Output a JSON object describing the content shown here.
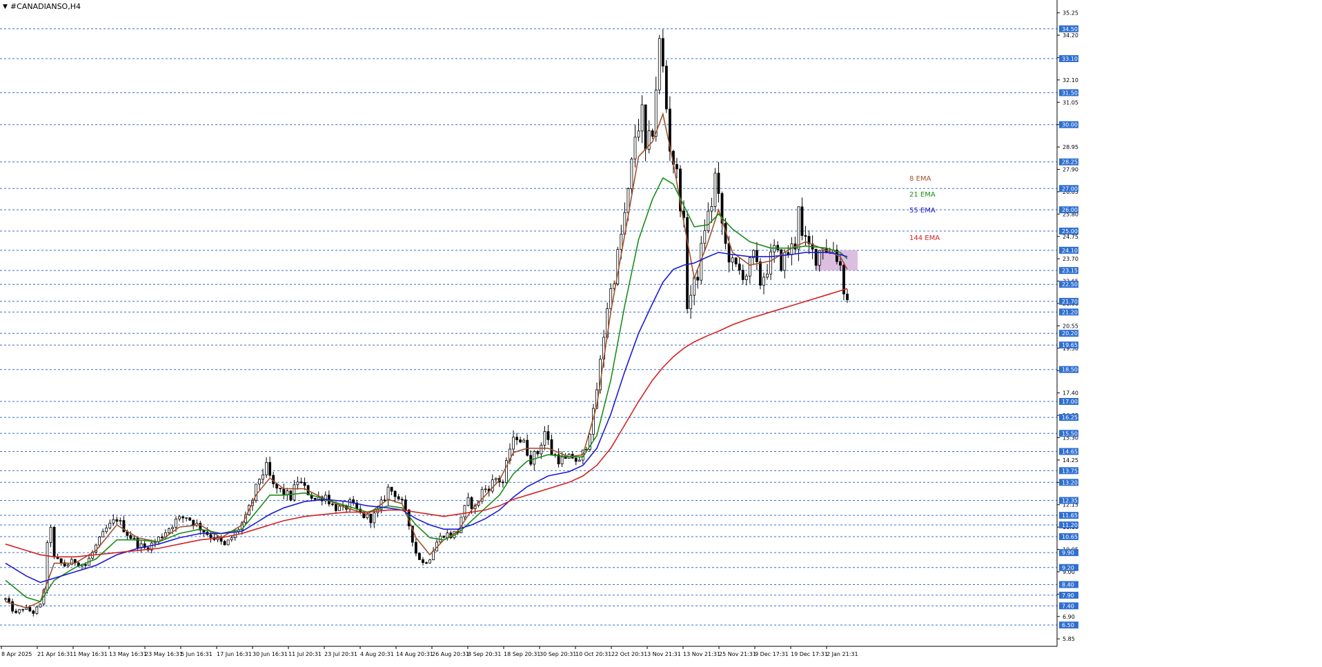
{
  "window": {
    "title": "#CANADIANSO,H4"
  },
  "chart_data": {
    "type": "line",
    "title": "#CANADIANSO,H4",
    "ylim": [
      5.5,
      35.4
    ],
    "price_axis_ticks": [
      "35.25",
      "34.20",
      "33.15",
      "32.10",
      "31.05",
      "30.00",
      "28.95",
      "27.90",
      "26.85",
      "25.80",
      "24.75",
      "23.70",
      "22.65",
      "21.60",
      "20.55",
      "19.50",
      "18.45",
      "17.40",
      "16.35",
      "15.30",
      "14.25",
      "13.20",
      "12.15",
      "11.10",
      "10.05",
      "9.00",
      "7.95",
      "6.90",
      "5.85"
    ],
    "x_axis_labels": [
      "8 Apr 2025",
      "21 Apr 16:31",
      "1 May 16:31",
      "13 May 16:31",
      "23 May 16:31",
      "5 Jun 16:31",
      "17 Jun 16:31",
      "30 Jun 16:31",
      "11 Jul 20:31",
      "23 Jul 20:31",
      "4 Aug 20:31",
      "14 Aug 20:31",
      "26 Aug 20:31",
      "8 Sep 20:31",
      "18 Sep 20:31",
      "30 Sep 20:31",
      "10 Oct 20:31",
      "22 Oct 20:31",
      "3 Nov 21:31",
      "13 Nov 21:31",
      "25 Nov 21:31",
      "9 Dec 17:31",
      "19 Dec 17:31",
      "2 Jan 21:31"
    ],
    "horizontal_levels": [
      "34.50",
      "33.10",
      "31.50",
      "30.00",
      "28.25",
      "27.00",
      "26.00",
      "25.00",
      "24.10",
      "23.15",
      "22.50",
      "21.70",
      "21.20",
      "20.20",
      "19.65",
      "18.50",
      "17.00",
      "16.25",
      "15.50",
      "14.65",
      "13.75",
      "13.20",
      "12.35",
      "11.65",
      "11.20",
      "10.65",
      "9.90",
      "9.20",
      "8.40",
      "7.90",
      "7.40",
      "6.50"
    ],
    "level_color": "#2f6fd1",
    "zone": {
      "from": 23.15,
      "to": 24.1,
      "color": "#d8b7de"
    },
    "colors": {
      "bull_candle": "#ffffff",
      "bear_candle": "#000000",
      "wick": "#000000"
    },
    "ohlc_points": [
      [
        0,
        7.7
      ],
      [
        3,
        7.0
      ],
      [
        5,
        7.3
      ],
      [
        8,
        7.1
      ],
      [
        10,
        7.4
      ],
      [
        11,
        8.2
      ],
      [
        12,
        10.2
      ],
      [
        13,
        11.2
      ],
      [
        14,
        9.6
      ],
      [
        17,
        9.3
      ],
      [
        20,
        9.5
      ],
      [
        23,
        9.3
      ],
      [
        26,
        10.2
      ],
      [
        29,
        11.0
      ],
      [
        32,
        11.5
      ],
      [
        35,
        10.8
      ],
      [
        38,
        10.3
      ],
      [
        40,
        10.1
      ],
      [
        43,
        10.4
      ],
      [
        46,
        10.9
      ],
      [
        49,
        11.4
      ],
      [
        52,
        11.6
      ],
      [
        55,
        11.2
      ],
      [
        58,
        10.8
      ],
      [
        61,
        10.5
      ],
      [
        63,
        10.2
      ],
      [
        66,
        10.8
      ],
      [
        69,
        11.5
      ],
      [
        71,
        12.4
      ],
      [
        73,
        13.4
      ],
      [
        75,
        13.9
      ],
      [
        77,
        13.0
      ],
      [
        79,
        12.8
      ],
      [
        82,
        12.5
      ],
      [
        84,
        13.3
      ],
      [
        86,
        12.9
      ],
      [
        89,
        12.4
      ],
      [
        92,
        12.6
      ],
      [
        94,
        12.1
      ],
      [
        97,
        11.9
      ],
      [
        99,
        12.2
      ],
      [
        102,
        11.7
      ],
      [
        105,
        11.5
      ],
      [
        107,
        11.8
      ],
      [
        110,
        12.9
      ],
      [
        112,
        12.7
      ],
      [
        114,
        12.2
      ],
      [
        116,
        11.2
      ],
      [
        118,
        9.9
      ],
      [
        120,
        9.4
      ],
      [
        122,
        9.7
      ],
      [
        124,
        10.4
      ],
      [
        126,
        10.8
      ],
      [
        128,
        10.7
      ],
      [
        130,
        10.9
      ],
      [
        131,
        11.6
      ],
      [
        133,
        12.3
      ],
      [
        135,
        12.0
      ],
      [
        137,
        12.8
      ],
      [
        139,
        13.0
      ],
      [
        141,
        13.4
      ],
      [
        143,
        13.2
      ],
      [
        145,
        14.8
      ],
      [
        147,
        15.4
      ],
      [
        149,
        15.0
      ],
      [
        151,
        14.3
      ],
      [
        153,
        14.6
      ],
      [
        155,
        15.6
      ],
      [
        157,
        14.6
      ],
      [
        159,
        14.3
      ],
      [
        161,
        14.2
      ],
      [
        163,
        14.4
      ],
      [
        165,
        14.1
      ],
      [
        167,
        15.0
      ],
      [
        169,
        16.4
      ],
      [
        171,
        18.8
      ],
      [
        173,
        21.5
      ],
      [
        175,
        22.9
      ],
      [
        177,
        24.8
      ],
      [
        179,
        26.7
      ],
      [
        181,
        29.5
      ],
      [
        183,
        30.5
      ],
      [
        184,
        28.6
      ],
      [
        186,
        29.8
      ],
      [
        188,
        33.8
      ],
      [
        189,
        32.6
      ],
      [
        190,
        30.8
      ],
      [
        191,
        29.0
      ],
      [
        193,
        27.6
      ],
      [
        195,
        25.2
      ],
      [
        196,
        21.6
      ],
      [
        197,
        22.0
      ],
      [
        199,
        23.0
      ],
      [
        201,
        25.2
      ],
      [
        203,
        26.3
      ],
      [
        204,
        27.6
      ],
      [
        205,
        26.4
      ],
      [
        207,
        24.3
      ],
      [
        209,
        23.4
      ],
      [
        211,
        23.1
      ],
      [
        213,
        23.0
      ],
      [
        215,
        23.8
      ],
      [
        217,
        22.6
      ],
      [
        219,
        23.3
      ],
      [
        221,
        24.1
      ],
      [
        223,
        23.5
      ],
      [
        225,
        24.0
      ],
      [
        227,
        24.4
      ],
      [
        228,
        26.4
      ],
      [
        229,
        24.6
      ],
      [
        231,
        24.2
      ],
      [
        233,
        23.8
      ],
      [
        235,
        24.4
      ],
      [
        237,
        24.0
      ],
      [
        238,
        24.2
      ],
      [
        240,
        23.4
      ],
      [
        241,
        22.3
      ],
      [
        242,
        21.7
      ]
    ],
    "series": [
      {
        "name": "8 EMA",
        "color": "#a0522d",
        "values": [
          [
            0,
            7.6
          ],
          [
            6,
            7.3
          ],
          [
            10,
            7.6
          ],
          [
            14,
            9.4
          ],
          [
            20,
            9.4
          ],
          [
            26,
            10.0
          ],
          [
            32,
            11.2
          ],
          [
            38,
            10.6
          ],
          [
            44,
            10.4
          ],
          [
            50,
            11.1
          ],
          [
            56,
            11.2
          ],
          [
            62,
            10.6
          ],
          [
            68,
            11.2
          ],
          [
            72,
            12.6
          ],
          [
            76,
            13.4
          ],
          [
            80,
            12.9
          ],
          [
            86,
            12.9
          ],
          [
            92,
            12.4
          ],
          [
            98,
            12.0
          ],
          [
            104,
            11.7
          ],
          [
            110,
            12.4
          ],
          [
            114,
            12.2
          ],
          [
            118,
            10.6
          ],
          [
            122,
            9.8
          ],
          [
            126,
            10.5
          ],
          [
            130,
            10.9
          ],
          [
            134,
            11.9
          ],
          [
            138,
            12.6
          ],
          [
            142,
            13.3
          ],
          [
            146,
            14.6
          ],
          [
            150,
            14.8
          ],
          [
            156,
            14.8
          ],
          [
            162,
            14.4
          ],
          [
            166,
            14.5
          ],
          [
            170,
            16.8
          ],
          [
            174,
            21.2
          ],
          [
            178,
            24.8
          ],
          [
            182,
            28.5
          ],
          [
            186,
            29.2
          ],
          [
            189,
            30.5
          ],
          [
            192,
            28.2
          ],
          [
            195,
            25.4
          ],
          [
            198,
            22.8
          ],
          [
            202,
            24.5
          ],
          [
            205,
            26.0
          ],
          [
            209,
            24.0
          ],
          [
            214,
            23.4
          ],
          [
            220,
            23.6
          ],
          [
            226,
            24.2
          ],
          [
            230,
            24.5
          ],
          [
            236,
            24.1
          ],
          [
            240,
            23.8
          ],
          [
            242,
            23.2
          ]
        ]
      },
      {
        "name": "21 EMA",
        "color": "#1a8c1a",
        "values": [
          [
            0,
            8.6
          ],
          [
            6,
            7.8
          ],
          [
            10,
            7.6
          ],
          [
            14,
            8.6
          ],
          [
            20,
            9.2
          ],
          [
            26,
            9.6
          ],
          [
            32,
            10.5
          ],
          [
            38,
            10.5
          ],
          [
            44,
            10.4
          ],
          [
            50,
            10.8
          ],
          [
            56,
            11.0
          ],
          [
            62,
            10.8
          ],
          [
            68,
            11.0
          ],
          [
            72,
            11.8
          ],
          [
            76,
            12.6
          ],
          [
            80,
            12.6
          ],
          [
            86,
            12.7
          ],
          [
            92,
            12.4
          ],
          [
            98,
            12.1
          ],
          [
            104,
            11.8
          ],
          [
            110,
            12.1
          ],
          [
            114,
            12.0
          ],
          [
            118,
            11.2
          ],
          [
            122,
            10.6
          ],
          [
            126,
            10.5
          ],
          [
            130,
            10.8
          ],
          [
            134,
            11.4
          ],
          [
            138,
            12.0
          ],
          [
            142,
            12.6
          ],
          [
            146,
            13.6
          ],
          [
            150,
            14.2
          ],
          [
            156,
            14.5
          ],
          [
            162,
            14.4
          ],
          [
            166,
            14.4
          ],
          [
            170,
            15.4
          ],
          [
            174,
            18.0
          ],
          [
            178,
            21.5
          ],
          [
            182,
            24.6
          ],
          [
            186,
            26.5
          ],
          [
            189,
            27.5
          ],
          [
            192,
            27.2
          ],
          [
            195,
            26.2
          ],
          [
            198,
            25.2
          ],
          [
            202,
            25.3
          ],
          [
            205,
            25.8
          ],
          [
            209,
            25.1
          ],
          [
            214,
            24.5
          ],
          [
            220,
            24.2
          ],
          [
            226,
            24.2
          ],
          [
            230,
            24.3
          ],
          [
            236,
            24.2
          ],
          [
            240,
            24.0
          ],
          [
            242,
            23.7
          ]
        ]
      },
      {
        "name": "55 EMA",
        "color": "#1a1ad6",
        "values": [
          [
            0,
            9.4
          ],
          [
            6,
            8.8
          ],
          [
            10,
            8.5
          ],
          [
            14,
            8.7
          ],
          [
            20,
            9.0
          ],
          [
            26,
            9.3
          ],
          [
            32,
            9.8
          ],
          [
            38,
            10.1
          ],
          [
            44,
            10.3
          ],
          [
            50,
            10.6
          ],
          [
            56,
            10.8
          ],
          [
            62,
            10.8
          ],
          [
            68,
            10.9
          ],
          [
            72,
            11.3
          ],
          [
            76,
            11.7
          ],
          [
            80,
            12.0
          ],
          [
            86,
            12.3
          ],
          [
            92,
            12.4
          ],
          [
            98,
            12.3
          ],
          [
            104,
            12.1
          ],
          [
            110,
            12.0
          ],
          [
            114,
            11.9
          ],
          [
            118,
            11.5
          ],
          [
            122,
            11.2
          ],
          [
            126,
            11.0
          ],
          [
            130,
            11.0
          ],
          [
            134,
            11.2
          ],
          [
            138,
            11.5
          ],
          [
            142,
            11.9
          ],
          [
            146,
            12.5
          ],
          [
            150,
            13.0
          ],
          [
            156,
            13.5
          ],
          [
            162,
            13.7
          ],
          [
            166,
            14.0
          ],
          [
            170,
            14.8
          ],
          [
            174,
            16.4
          ],
          [
            178,
            18.4
          ],
          [
            182,
            20.2
          ],
          [
            186,
            21.6
          ],
          [
            189,
            22.6
          ],
          [
            192,
            23.2
          ],
          [
            195,
            23.4
          ],
          [
            198,
            23.5
          ],
          [
            202,
            23.8
          ],
          [
            205,
            24.0
          ],
          [
            209,
            23.9
          ],
          [
            214,
            23.8
          ],
          [
            220,
            23.8
          ],
          [
            226,
            23.9
          ],
          [
            230,
            24.0
          ],
          [
            236,
            24.0
          ],
          [
            240,
            23.9
          ],
          [
            242,
            23.8
          ]
        ]
      },
      {
        "name": "144 EMA",
        "color": "#d42020",
        "values": [
          [
            0,
            10.3
          ],
          [
            6,
            10.0
          ],
          [
            10,
            9.8
          ],
          [
            14,
            9.7
          ],
          [
            20,
            9.7
          ],
          [
            26,
            9.8
          ],
          [
            32,
            9.9
          ],
          [
            38,
            10.0
          ],
          [
            44,
            10.1
          ],
          [
            50,
            10.3
          ],
          [
            56,
            10.5
          ],
          [
            62,
            10.6
          ],
          [
            68,
            10.8
          ],
          [
            72,
            11.0
          ],
          [
            76,
            11.2
          ],
          [
            80,
            11.4
          ],
          [
            86,
            11.6
          ],
          [
            92,
            11.7
          ],
          [
            98,
            11.8
          ],
          [
            104,
            11.8
          ],
          [
            110,
            11.9
          ],
          [
            114,
            11.9
          ],
          [
            118,
            11.8
          ],
          [
            122,
            11.7
          ],
          [
            126,
            11.6
          ],
          [
            130,
            11.7
          ],
          [
            134,
            11.8
          ],
          [
            138,
            11.9
          ],
          [
            142,
            12.1
          ],
          [
            146,
            12.4
          ],
          [
            150,
            12.6
          ],
          [
            156,
            12.9
          ],
          [
            162,
            13.2
          ],
          [
            166,
            13.5
          ],
          [
            170,
            14.0
          ],
          [
            174,
            14.8
          ],
          [
            178,
            15.9
          ],
          [
            182,
            17.0
          ],
          [
            186,
            18.0
          ],
          [
            189,
            18.6
          ],
          [
            192,
            19.1
          ],
          [
            195,
            19.5
          ],
          [
            198,
            19.8
          ],
          [
            202,
            20.1
          ],
          [
            205,
            20.3
          ],
          [
            209,
            20.6
          ],
          [
            214,
            20.9
          ],
          [
            220,
            21.2
          ],
          [
            226,
            21.5
          ],
          [
            230,
            21.7
          ],
          [
            236,
            22.0
          ],
          [
            240,
            22.2
          ],
          [
            242,
            22.3
          ]
        ]
      }
    ]
  }
}
